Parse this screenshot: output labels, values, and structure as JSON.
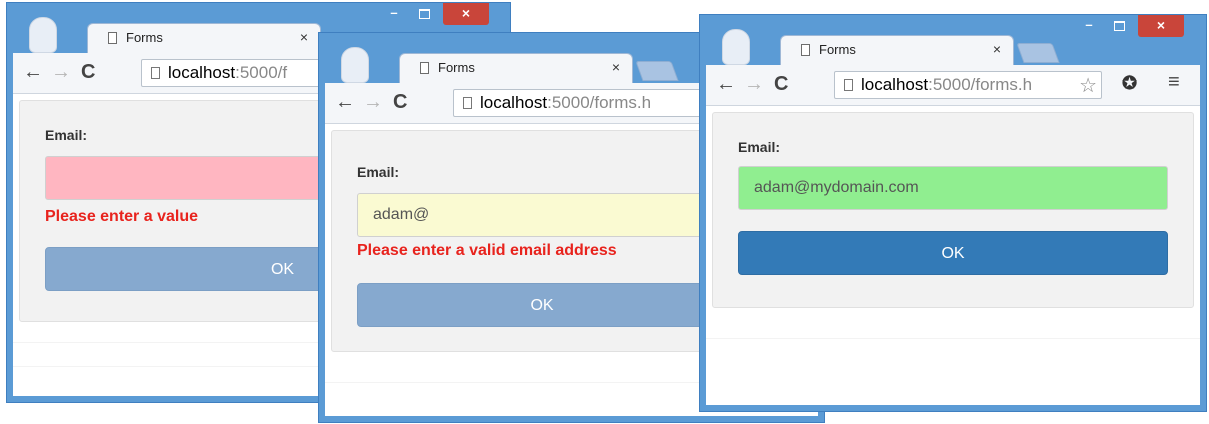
{
  "windows": [
    {
      "tab_title": "Forms",
      "url_host": "localhost",
      "url_rest": ":5000/f",
      "email_label": "Email:",
      "email_value": "",
      "error": "Please enter a value",
      "ok_label": "OK",
      "field_color": "#ffb6c1",
      "button_color": "#86a9cf"
    },
    {
      "tab_title": "Forms",
      "url_host": "localhost",
      "url_rest": ":5000/forms.h",
      "email_label": "Email:",
      "email_value": "adam@",
      "error": "Please enter a valid email address",
      "ok_label": "OK",
      "field_color": "#fafad2",
      "button_color": "#86a9cf"
    },
    {
      "tab_title": "Forms",
      "url_host": "localhost",
      "url_rest": ":5000/forms.h",
      "email_label": "Email:",
      "email_value": "adam@mydomain.com",
      "error": "",
      "ok_label": "OK",
      "field_color": "#90ee90",
      "button_color": "#337ab7"
    }
  ],
  "icons": {
    "tab_close": "×",
    "back": "←",
    "forward": "→",
    "reload": "C",
    "close": "×",
    "minimize": "–",
    "star": "☆",
    "extension": "✪",
    "menu": "≡"
  }
}
